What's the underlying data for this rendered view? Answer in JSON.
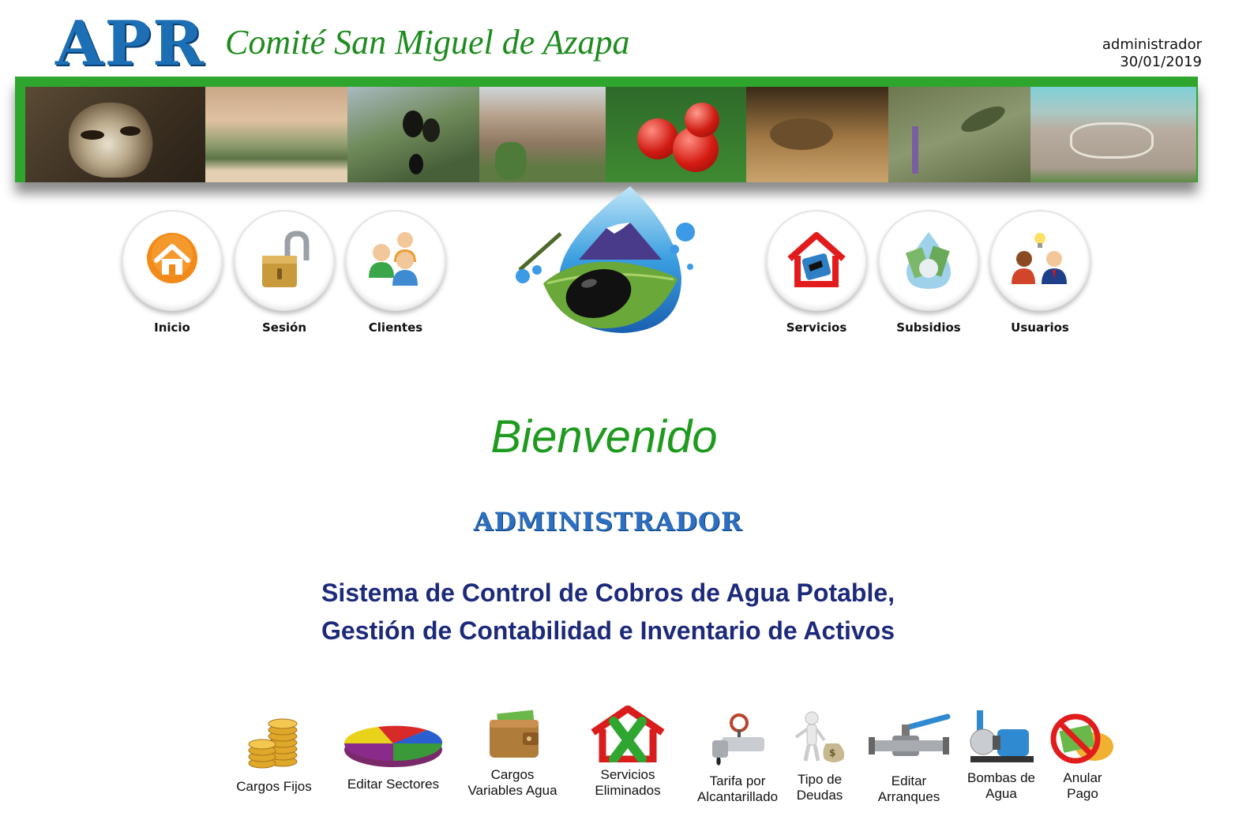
{
  "header": {
    "logo": "APR",
    "title": "Comité San Miguel de Azapa",
    "user": "administrador",
    "date": "30/01/2019"
  },
  "colors": {
    "brand_green": "#2ea62e",
    "brand_blue": "#1d6fb5",
    "heading_navy": "#1d2a7a"
  },
  "banner": {
    "tiles": [
      "mummy-photo",
      "valley-photo",
      "olives-photo",
      "hill-cactus-photo",
      "tomatoes-photo",
      "hands-crafts-photo",
      "hummingbird-photo",
      "geoglyph-photo"
    ]
  },
  "nav": {
    "items": [
      {
        "label": "Inicio",
        "icon": "home-icon"
      },
      {
        "label": "Sesión",
        "icon": "padlock-icon"
      },
      {
        "label": "Clientes",
        "icon": "people-icon"
      },
      {
        "label": "Servicios",
        "icon": "house-service-icon"
      },
      {
        "label": "Subsidios",
        "icon": "water-drop-money-icon"
      },
      {
        "label": "Usuarios",
        "icon": "users-idea-icon"
      }
    ]
  },
  "main": {
    "welcome": "Bienvenido",
    "role": "ADMINISTRADOR",
    "system_line1": "Sistema de Control de Cobros de Agua Potable,",
    "system_line2": "Gestión de Contabilidad e Inventario de Activos"
  },
  "tools": {
    "items": [
      {
        "label": "Cargos Fijos",
        "icon": "coins-icon"
      },
      {
        "label": "Editar Sectores",
        "icon": "pie-chart-icon"
      },
      {
        "label": "Cargos Variables Agua",
        "icon": "wallet-icon"
      },
      {
        "label": "Servicios Eliminados",
        "icon": "house-x-icon"
      },
      {
        "label": "Tarifa por Alcantarillado",
        "icon": "sewer-pipe-icon"
      },
      {
        "label": "Tipo de Deudas",
        "icon": "person-money-bag-icon"
      },
      {
        "label": "Editar Arranques",
        "icon": "valve-icon"
      },
      {
        "label": "Bombas de Agua",
        "icon": "water-pump-icon"
      },
      {
        "label": "Anular Pago",
        "icon": "no-money-icon"
      }
    ]
  }
}
